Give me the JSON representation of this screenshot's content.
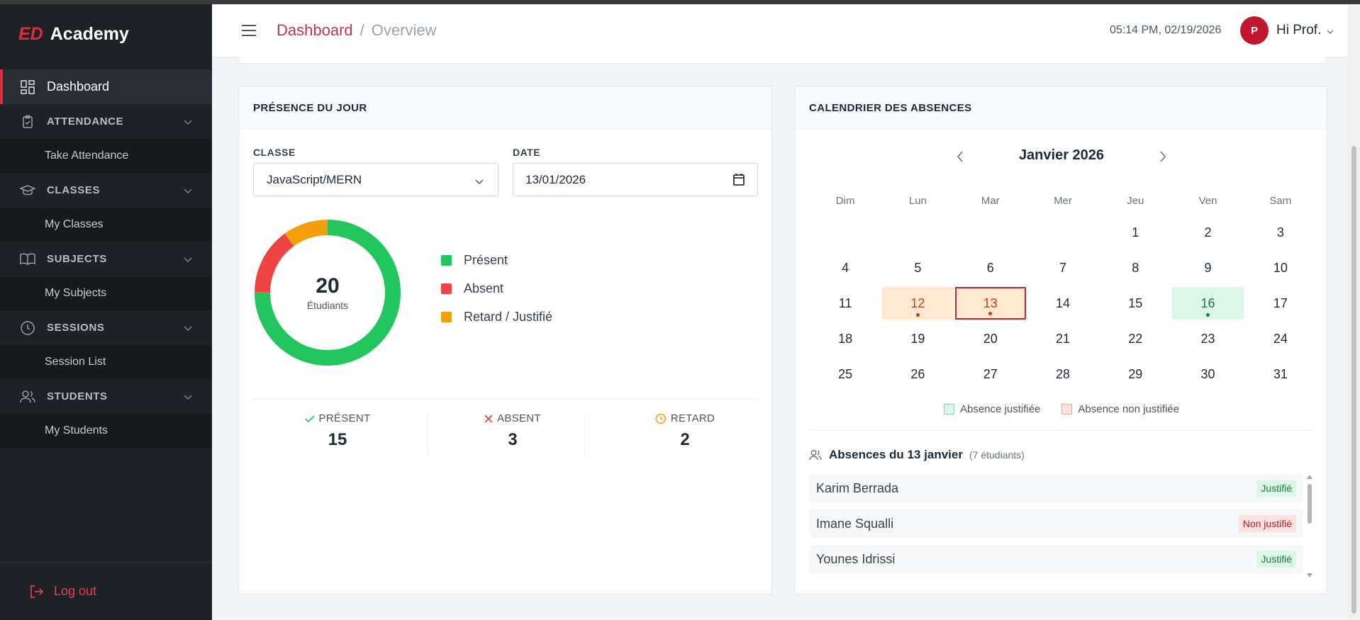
{
  "app": {
    "logo_prefix": "ED",
    "logo_name": "Academy"
  },
  "sidebar": {
    "dashboard": "Dashboard",
    "sections": [
      {
        "label": "ATTENDANCE",
        "sub": "Take Attendance",
        "icon": "clipboard-icon"
      },
      {
        "label": "CLASSES",
        "sub": "My Classes",
        "icon": "graduation-cap-icon"
      },
      {
        "label": "SUBJECTS",
        "sub": "My Subjects",
        "icon": "book-icon"
      },
      {
        "label": "SESSIONS",
        "sub": "Session List",
        "icon": "clock-icon"
      },
      {
        "label": "STUDENTS",
        "sub": "My Students",
        "icon": "users-icon"
      }
    ],
    "logout": "Log out"
  },
  "header": {
    "breadcrumb": [
      "Dashboard",
      "Overview"
    ],
    "separator": "/",
    "datetime": "05:14 PM, 02/19/2026",
    "avatar_initial": "P",
    "greeting": "Hi Prof."
  },
  "presence": {
    "title": "PRÉSENCE DU JOUR",
    "class_label": "CLASSE",
    "class_value": "JavaScript/MERN",
    "date_label": "DATE",
    "date_value": "13/01/2026",
    "total": "20",
    "total_caption": "Étudiants",
    "legend": [
      {
        "label": "Présent",
        "color": "#22c55e"
      },
      {
        "label": "Absent",
        "color": "#ef4444"
      },
      {
        "label": "Retard / Justifié",
        "color": "#f59e0b"
      }
    ],
    "stats": [
      {
        "label": "PRÉSENT",
        "value": "15",
        "icon": "check-icon",
        "color": "#22c55e"
      },
      {
        "label": "ABSENT",
        "value": "3",
        "icon": "x-icon",
        "color": "#ef4444"
      },
      {
        "label": "RETARD",
        "value": "2",
        "icon": "clock-icon",
        "color": "#f59e0b"
      }
    ],
    "donut": [
      15,
      3,
      2
    ]
  },
  "calendar": {
    "title": "CALENDRIER DES ABSENCES",
    "month": "Janvier 2026",
    "weekdays": [
      "Dim",
      "Lun",
      "Mar",
      "Mer",
      "Jeu",
      "Ven",
      "Sam"
    ],
    "first_weekday_index": 4,
    "days_in_month": 31,
    "marked": {
      "12": "non-justified",
      "13": "non-justified",
      "16": "justified"
    },
    "selected_day": 13,
    "legend": [
      "Absence justifiée",
      "Absence non justifiée"
    ],
    "absences_title": "Absences du 13 janvier",
    "absences_count": "(7 étudiants)",
    "absences": [
      {
        "name": "Karim Berrada",
        "status": "Justifié",
        "justified": true
      },
      {
        "name": "Imane Squalli",
        "status": "Non justifié",
        "justified": false
      },
      {
        "name": "Younes Idrissi",
        "status": "Justifié",
        "justified": true
      }
    ]
  },
  "colors": {
    "accent": "#dc2d3c",
    "sidebar_bg": "#1e2126",
    "present": "#22c55e",
    "absent": "#ef4444",
    "late": "#f59e0b"
  }
}
